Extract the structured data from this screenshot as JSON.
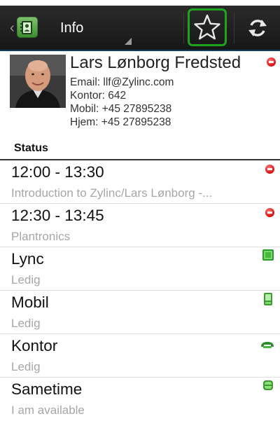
{
  "app": {
    "title": "Info",
    "accent_color": "#1ea51e",
    "icons": [
      "back-chevron-icon",
      "contacts-app-icon",
      "star-icon",
      "refresh-icon"
    ]
  },
  "contact": {
    "name": "Lars Lønborg Fredsted",
    "email": "Email: llf@Zylinc.com",
    "office": "Kontor: 642",
    "mobile": "Mobil: +45 27895238",
    "home": "Hjem: +45 27895238",
    "presence": "busy"
  },
  "status_section": {
    "title": "Status",
    "items": [
      {
        "title": "12:00 - 13:30",
        "subtitle": "Introduction to Zylinc/Lars Lønborg -...",
        "icon": "busy-icon"
      },
      {
        "title": "12:30 - 13:45",
        "subtitle": "Plantronics",
        "icon": "busy-icon"
      },
      {
        "title": "Lync",
        "subtitle": "Ledig",
        "icon": "lync-available-icon"
      },
      {
        "title": "Mobil",
        "subtitle": "Ledig",
        "icon": "mobile-phone-icon"
      },
      {
        "title": "Kontor",
        "subtitle": "Ledig",
        "icon": "desk-phone-icon"
      },
      {
        "title": "Sametime",
        "subtitle": "I am available",
        "icon": "sametime-available-icon"
      }
    ]
  }
}
